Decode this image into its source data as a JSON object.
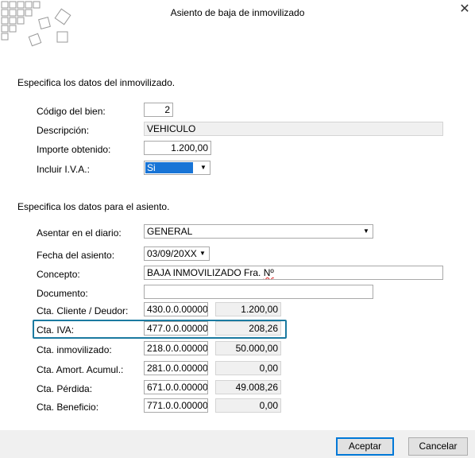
{
  "window": {
    "title": "Asiento de baja de inmovilizado",
    "close_glyph": "✕"
  },
  "section1": {
    "heading": "Especifica  los datos del inmovilizado.",
    "codigo": {
      "label": "Código del bien:",
      "value": "2"
    },
    "descripcion": {
      "label": "Descripción:",
      "value": "VEHICULO"
    },
    "importe": {
      "label": "Importe obtenido:",
      "value": "1.200,00"
    },
    "iva": {
      "label": "Incluir I.V.A.:",
      "value": "Si"
    }
  },
  "section2": {
    "heading": "Especifica los datos para el asiento.",
    "diario": {
      "label": "Asentar en el diario:",
      "value": "GENERAL"
    },
    "fecha": {
      "label": "Fecha del asiento:",
      "value": "03/09/20XX"
    },
    "concepto": {
      "label": "Concepto:",
      "value_main": "BAJA INMOVILIZADO Fra. ",
      "value_flagged": "Nº"
    },
    "documento": {
      "label": "Documento:",
      "value": ""
    },
    "rows": [
      {
        "label": "Cta. Cliente / Deudor:",
        "account": "430.0.0.00000",
        "amount": "1.200,00"
      },
      {
        "label": "Cta. IVA:",
        "account": "477.0.0.00000",
        "amount": "208,26"
      },
      {
        "label": "Cta. inmovilizado:",
        "account": "218.0.0.00000",
        "amount": "50.000,00"
      },
      {
        "label": "Cta. Amort. Acumul.:",
        "account": "281.0.0.00000",
        "amount": "0,00"
      },
      {
        "label": "Cta. Pérdida:",
        "account": "671.0.0.00000",
        "amount": "49.008,26"
      },
      {
        "label": "Cta. Beneficio:",
        "account": "771.0.0.00000",
        "amount": "0,00"
      }
    ]
  },
  "buttons": {
    "accept": "Aceptar",
    "cancel": "Cancelar"
  },
  "colors": {
    "selection": "#1874d6",
    "highlight_border": "#1b7aa0",
    "default_button_border": "#0078d7"
  },
  "icons": {
    "dropdown": "▼"
  }
}
